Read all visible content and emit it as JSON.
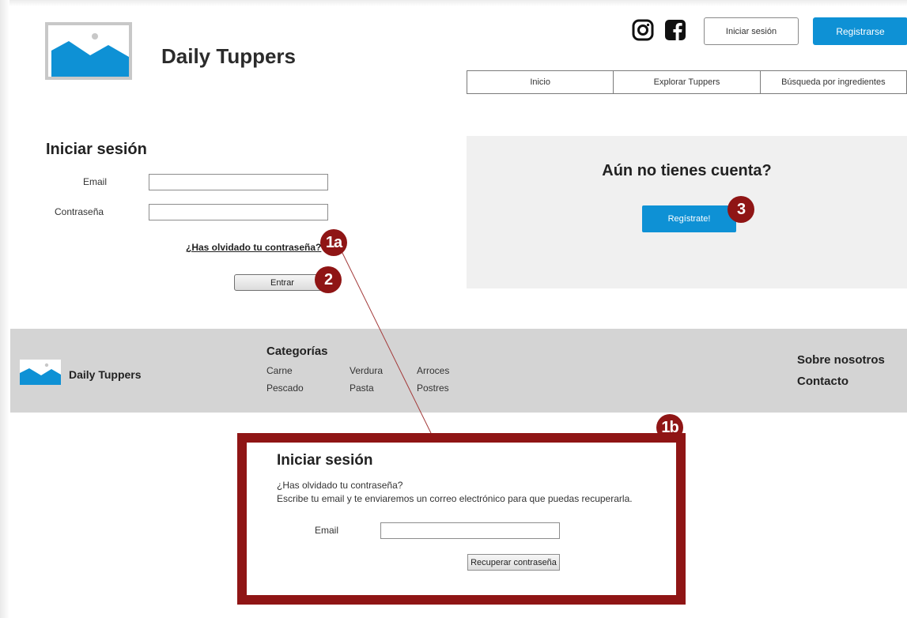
{
  "header": {
    "brand": "Daily Tuppers",
    "login_button": "Iniciar sesión",
    "register_button": "Registrarse",
    "social": [
      "instagram-icon",
      "facebook-icon"
    ]
  },
  "nav": {
    "items": [
      "Inicio",
      "Explorar Tuppers",
      "Búsqueda por ingredientes"
    ]
  },
  "login": {
    "title": "Iniciar sesión",
    "email_label": "Email",
    "password_label": "Contraseña",
    "email_value": "",
    "password_value": "",
    "forgot_link": "¿Has olvidado tu contraseña?",
    "submit": "Entrar"
  },
  "register_panel": {
    "title": "Aún no tienes cuenta?",
    "button": "Regístrate!"
  },
  "footer": {
    "brand": "Daily Tuppers",
    "categories_title": "Categorías",
    "categories": [
      "Carne",
      "Verdura",
      "Arroces",
      "Pescado",
      "Pasta",
      "Postres"
    ],
    "links": [
      "Sobre nosotros",
      "Contacto"
    ]
  },
  "annotations": {
    "badge_1a": "1a",
    "badge_1b": "1b",
    "badge_2": "2",
    "badge_3": "3"
  },
  "recovery": {
    "title": "Iniciar sesión",
    "line1": "¿Has olvidado tu contraseña?",
    "line2": "Escribe tu email y te enviaremos un correo electrónico para que puedas recuperarla.",
    "email_label": "Email",
    "email_value": "",
    "button": "Recuperar contraseña"
  },
  "colors": {
    "primary": "#0e91d5",
    "annotation": "#8f1515",
    "footer_bg": "#d4d4d4",
    "panel_bg": "#f0f0f0"
  }
}
